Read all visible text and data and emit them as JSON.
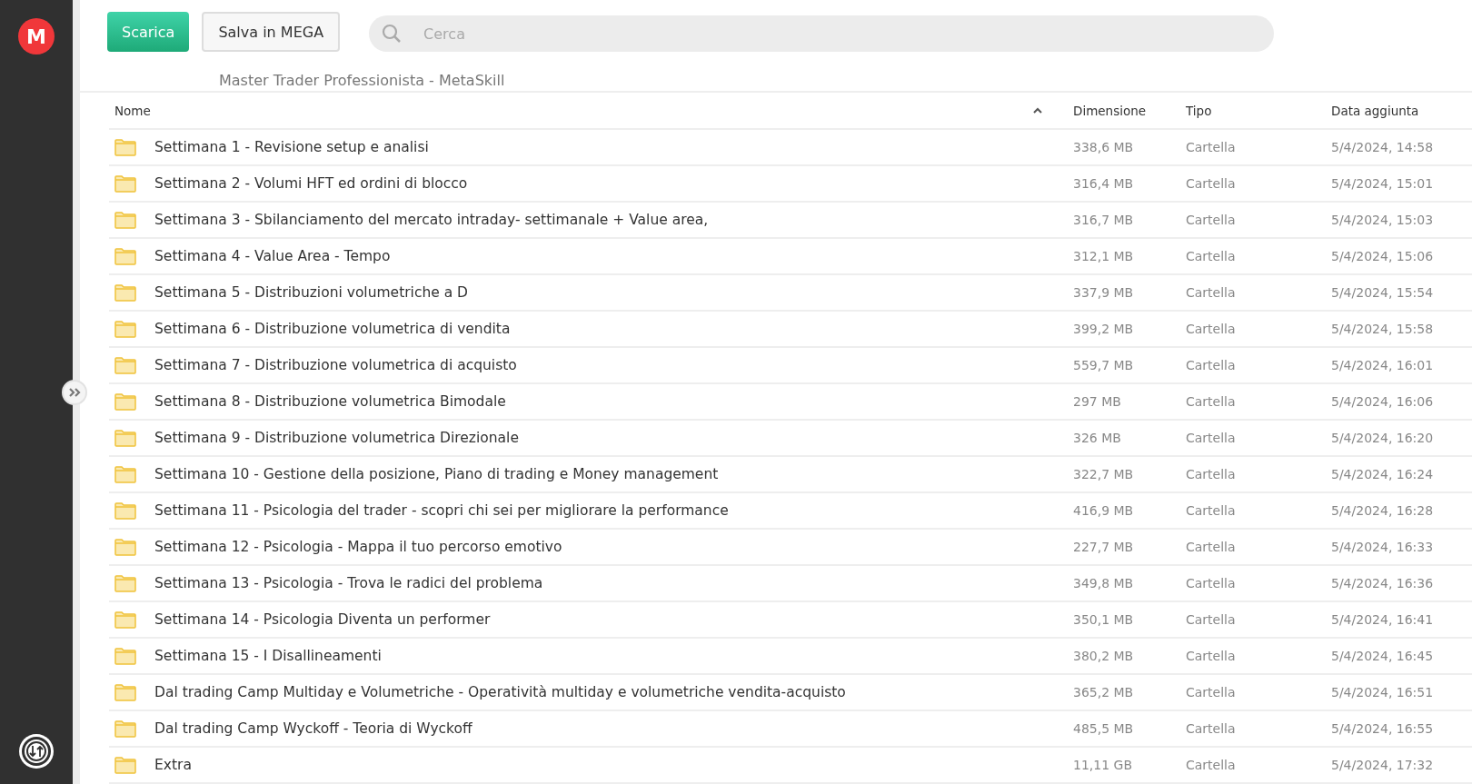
{
  "sidebar": {
    "logo": "M"
  },
  "toolbar": {
    "buttons": [
      {
        "label": "Scarica",
        "kind": "primary"
      },
      {
        "label": "Salva in MEGA",
        "kind": "secondary"
      }
    ],
    "search": {
      "placeholder": "Cerca"
    }
  },
  "breadcrumb": "Master Trader Professionista - MetaSkill",
  "table": {
    "columns": [
      "Nome",
      "Dimensione",
      "Tipo",
      "Data aggiunta"
    ],
    "rows": [
      {
        "name": "Settimana 1 - Revisione setup e analisi",
        "size": "338,6 MB",
        "type": "Cartella",
        "date": "5/4/2024, 14:58"
      },
      {
        "name": "Settimana 2 - Volumi HFT ed ordini di blocco",
        "size": "316,4 MB",
        "type": "Cartella",
        "date": "5/4/2024, 15:01"
      },
      {
        "name": "Settimana 3 - Sbilanciamento del mercato intraday- settimanale + Value area,",
        "size": "316,7 MB",
        "type": "Cartella",
        "date": "5/4/2024, 15:03"
      },
      {
        "name": "Settimana 4 - Value Area - Tempo",
        "size": "312,1 MB",
        "type": "Cartella",
        "date": "5/4/2024, 15:06"
      },
      {
        "name": "Settimana 5 - Distribuzioni volumetriche a D",
        "size": "337,9 MB",
        "type": "Cartella",
        "date": "5/4/2024, 15:54"
      },
      {
        "name": "Settimana 6 - Distribuzione volumetrica di vendita",
        "size": "399,2 MB",
        "type": "Cartella",
        "date": "5/4/2024, 15:58"
      },
      {
        "name": "Settimana 7 - Distribuzione volumetrica di acquisto",
        "size": "559,7 MB",
        "type": "Cartella",
        "date": "5/4/2024, 16:01"
      },
      {
        "name": "Settimana 8 - Distribuzione volumetrica Bimodale",
        "size": "297 MB",
        "type": "Cartella",
        "date": "5/4/2024, 16:06"
      },
      {
        "name": "Settimana 9 - Distribuzione volumetrica Direzionale",
        "size": "326 MB",
        "type": "Cartella",
        "date": "5/4/2024, 16:20"
      },
      {
        "name": "Settimana 10 - Gestione della posizione, Piano di trading e Money management",
        "size": "322,7 MB",
        "type": "Cartella",
        "date": "5/4/2024, 16:24"
      },
      {
        "name": "Settimana 11 - Psicologia del trader - scopri chi sei per migliorare la performance",
        "size": "416,9 MB",
        "type": "Cartella",
        "date": "5/4/2024, 16:28"
      },
      {
        "name": "Settimana 12 - Psicologia - Mappa il tuo percorso emotivo",
        "size": "227,7 MB",
        "type": "Cartella",
        "date": "5/4/2024, 16:33"
      },
      {
        "name": "Settimana 13 - Psicologia - Trova le radici del problema",
        "size": "349,8 MB",
        "type": "Cartella",
        "date": "5/4/2024, 16:36"
      },
      {
        "name": "Settimana 14 - Psicologia Diventa un performer",
        "size": "350,1 MB",
        "type": "Cartella",
        "date": "5/4/2024, 16:41"
      },
      {
        "name": "Settimana 15 - I Disallineamenti",
        "size": "380,2 MB",
        "type": "Cartella",
        "date": "5/4/2024, 16:45"
      },
      {
        "name": "Dal trading Camp Multiday e Volumetriche - Operatività multiday e volumetriche vendita-acquisto",
        "size": "365,2 MB",
        "type": "Cartella",
        "date": "5/4/2024, 16:51"
      },
      {
        "name": "Dal trading Camp Wyckoff - Teoria di Wyckoff",
        "size": "485,5 MB",
        "type": "Cartella",
        "date": "5/4/2024, 16:55"
      },
      {
        "name": "Extra",
        "size": "11,11 GB",
        "type": "Cartella",
        "date": "5/4/2024, 17:32"
      }
    ]
  }
}
